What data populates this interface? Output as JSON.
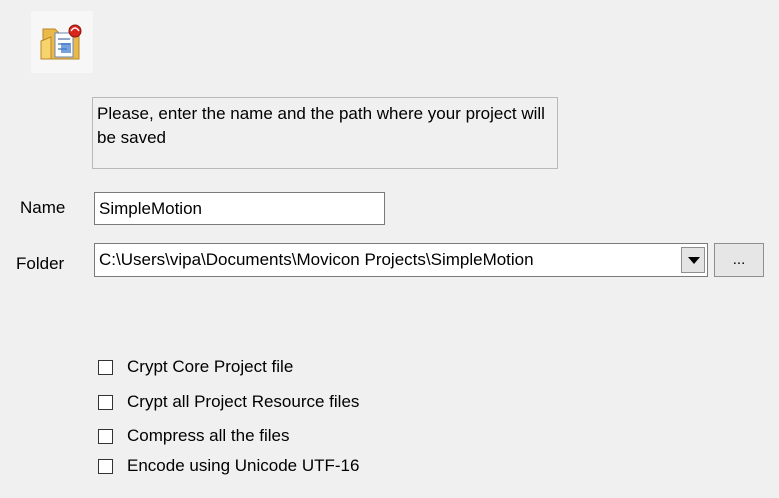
{
  "header": {
    "icon": "folder-project-icon"
  },
  "instruction_text": "Please, enter the name and the path where your project will be saved",
  "name_field": {
    "label": "Name",
    "value": "SimpleMotion"
  },
  "folder_field": {
    "label": "Folder",
    "value": "C:\\Users\\vipa\\Documents\\Movicon Projects\\SimpleMotion",
    "dropdown_icon": "chevron-down-icon"
  },
  "browse_button": {
    "label": "..."
  },
  "options": [
    {
      "label": "Crypt Core Project file",
      "checked": false
    },
    {
      "label": "Crypt all Project Resource files",
      "checked": false
    },
    {
      "label": "Compress all the files",
      "checked": false
    },
    {
      "label": "Encode using Unicode UTF-16",
      "checked": false
    }
  ],
  "colors": {
    "background": "#f0f0f0",
    "folder_yellow": "#f2c14e",
    "badge_red": "#d9261c"
  }
}
